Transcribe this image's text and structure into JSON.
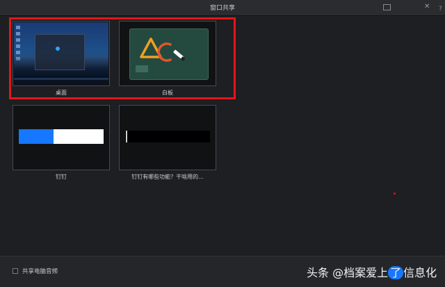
{
  "window": {
    "title": "窗口共享"
  },
  "tiles": [
    {
      "label": "桌面"
    },
    {
      "label": "白板"
    },
    {
      "label": "钉钉"
    },
    {
      "label": "钉钉有哪些功能？干啥用的..."
    }
  ],
  "footer": {
    "share_audio_label": "共享电脑音频",
    "share_audio_checked": false
  },
  "watermark": {
    "prefix": "头条 @档案爱上",
    "highlight": "了",
    "suffix": "信息化"
  },
  "colors": {
    "selection": "#e2161b",
    "accent_blue": "#1677ff"
  },
  "icons": [
    "close-icon",
    "maximize-icon",
    "pen-icon"
  ]
}
